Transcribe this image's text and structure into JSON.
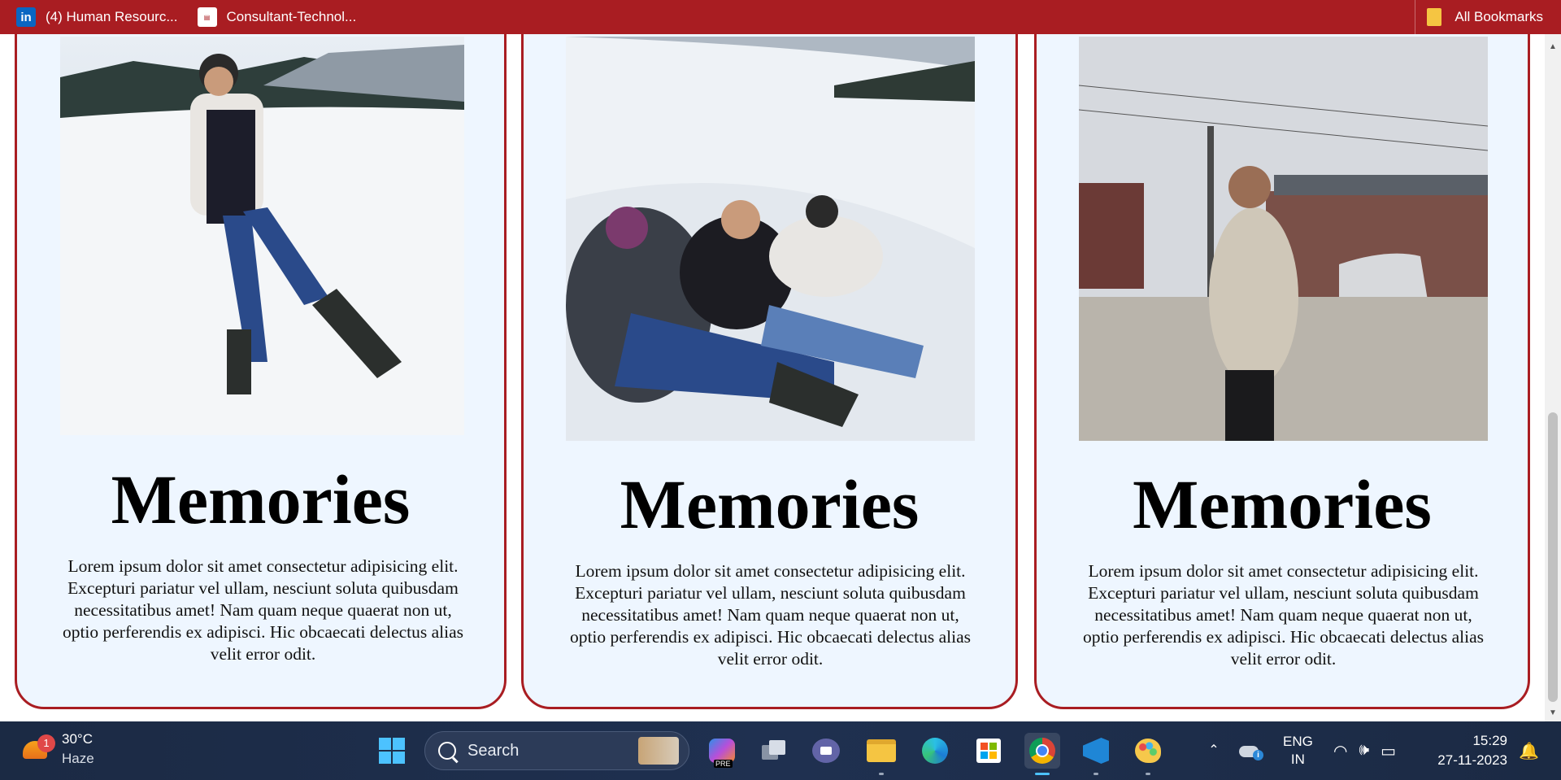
{
  "bookmarks": {
    "items": [
      {
        "label": "(4) Human Resourc...",
        "icon": "linkedin-icon"
      },
      {
        "label": "Consultant-Technol...",
        "icon": "site-favicon-icon"
      }
    ],
    "all_label": "All Bookmarks"
  },
  "cards": [
    {
      "title": "Memories",
      "text": "Lorem ipsum dolor sit amet consectetur adipisicing elit. Excepturi pariatur vel ullam, nesciunt soluta quibusdam necessitatibus amet! Nam quam neque quaerat non ut, optio perferendis ex adipisci. Hic obcaecati delectus alias velit error odit.",
      "photo": "person-in-snow-photo"
    },
    {
      "title": "Memories",
      "text": "Lorem ipsum dolor sit amet consectetur adipisicing elit. Excepturi pariatur vel ullam, nesciunt soluta quibusdam necessitatibus amet! Nam quam neque quaerat non ut, optio perferendis ex adipisci. Hic obcaecati delectus alias velit error odit.",
      "photo": "friends-lying-in-snow-photo"
    },
    {
      "title": "Memories",
      "text": "Lorem ipsum dolor sit amet consectetur adipisicing elit. Excepturi pariatur vel ullam, nesciunt soluta quibusdam necessitatibus amet! Nam quam neque quaerat non ut, optio perferendis ex adipisci. Hic obcaecati delectus alias velit error odit.",
      "photo": "person-on-street-photo"
    }
  ],
  "taskbar": {
    "weather": {
      "temp": "30°C",
      "condition": "Haze",
      "badge": "1"
    },
    "search_placeholder": "Search",
    "copilot_tag": "PRE",
    "tray": {
      "lang_top": "ENG",
      "lang_bottom": "IN",
      "time": "15:29",
      "date": "27-11-2023"
    }
  },
  "colors": {
    "accent": "#a91d22",
    "card_bg": "#eef6ff",
    "taskbar": "#1f3050"
  }
}
